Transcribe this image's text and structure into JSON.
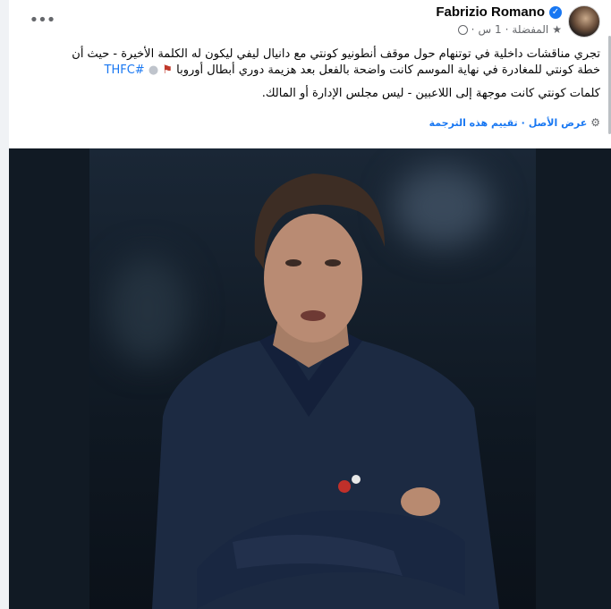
{
  "post": {
    "author_name": "Fabrizio Romano",
    "time": "1 س",
    "audience": "المفضلة",
    "more_label": "•••",
    "paragraph1": "تجري مناقشات داخلية في توتنهام حول موقف أنطونيو كونتي مع دانيال ليفي ليكون له الكلمة الأخيرة - حيث أن خطة كونتي للمغادرة في نهاية الموسم كانت واضحة بالفعل بعد هزيمة دوري أبطال أوروبا",
    "hashtag": "#THFC",
    "paragraph2": "كلمات كونتي كانت موجهة إلى اللاعبين - ليس مجلس الإدارة أو المالك.",
    "see_original": "عرض الأصل",
    "separator": "·",
    "rate_translation": "تقييم هذه الترجمة"
  },
  "icons": {
    "verified": "✓",
    "star": "★",
    "gear": "⚙",
    "red_emoji": "⚑",
    "ball_emoji": "●"
  },
  "colors": {
    "link": "#1877f2",
    "secondary_text": "#65676b",
    "verified": "#1877f2"
  }
}
